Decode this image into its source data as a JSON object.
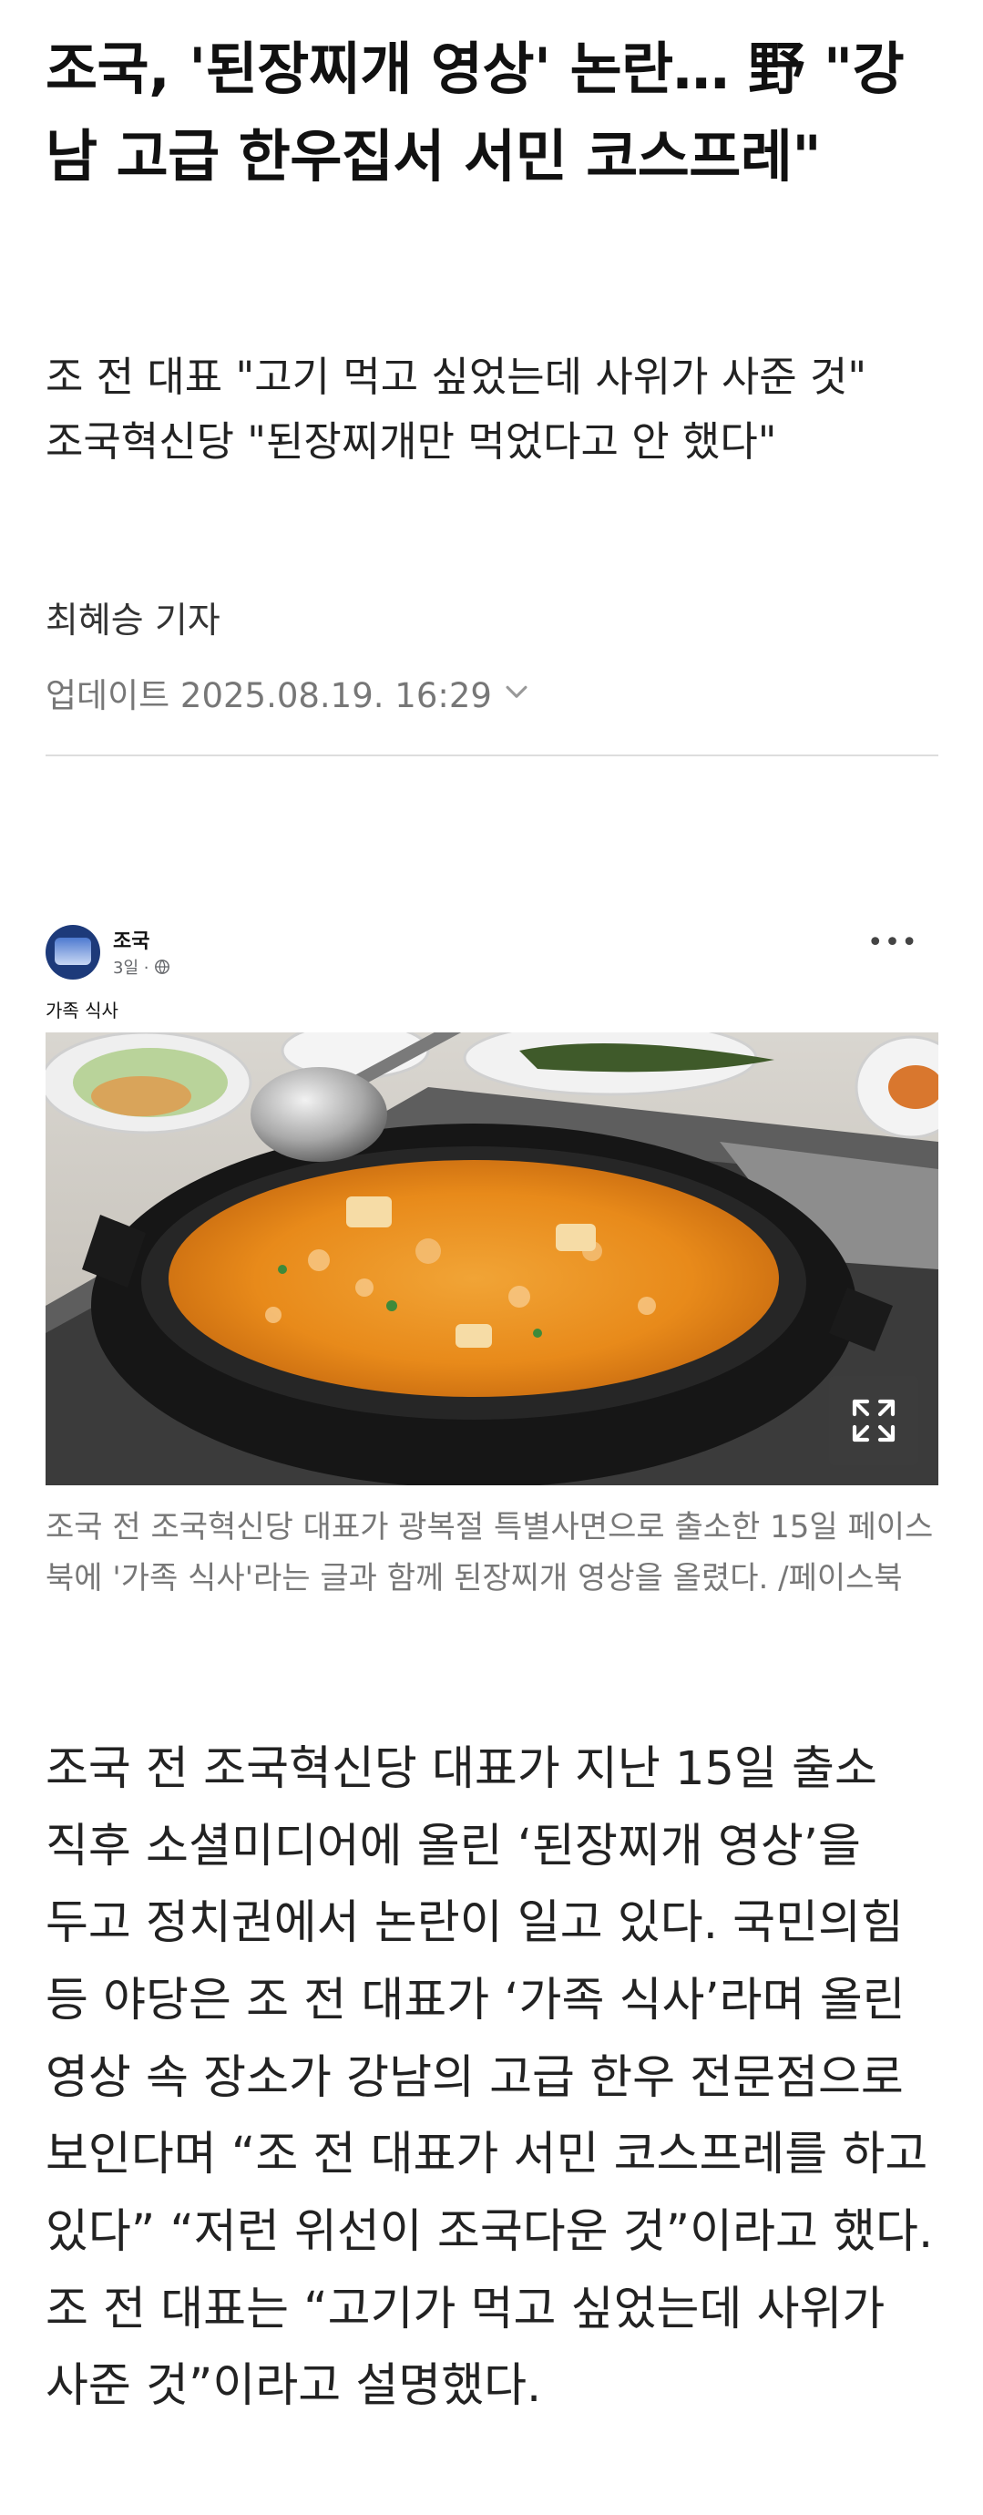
{
  "article": {
    "headline": "조국, '된장찌개 영상' 논란… 野 \"강남 고급 한우집서 서민 코스프레\"",
    "subheadings": [
      "조 전 대표 \"고기 먹고 싶었는데 사위가 사준 것\"",
      "조국혁신당 \"된장찌개만 먹었다고 안 했다\""
    ],
    "byline": "최혜승 기자",
    "updated": "업데이트 2025.08.19. 16:29"
  },
  "embed": {
    "author": "조국",
    "time": "3일 ·",
    "post_text": "가족 식사",
    "more_icon": "more-dots-icon",
    "privacy_icon": "globe-icon",
    "expand_icon": "expand-arrows-icon"
  },
  "photo_caption": "조국 전 조국혁신당 대표가 광복절 특별사면으로 출소한 15일 페이스북에 '가족 식사'라는 글과 함께 된장찌개 영상을 올렸다. /페이스북",
  "body": "조국 전 조국혁신당 대표가 지난 15일 출소 직후 소셜미디어에 올린 ‘된장찌개 영상’을 두고 정치권에서 논란이 일고 있다. 국민의힘 등 야당은 조 전 대표가 ‘가족 식사’라며 올린 영상 속 장소가 강남의 고급 한우 전문점으로 보인다며 “조 전 대표가 서민 코스프레를 하고 있다” “저런 위선이 조국다운 것”이라고 했다. 조 전 대표는 “고기가 먹고 싶었는데 사위가 사준 것”이라고 설명했다."
}
